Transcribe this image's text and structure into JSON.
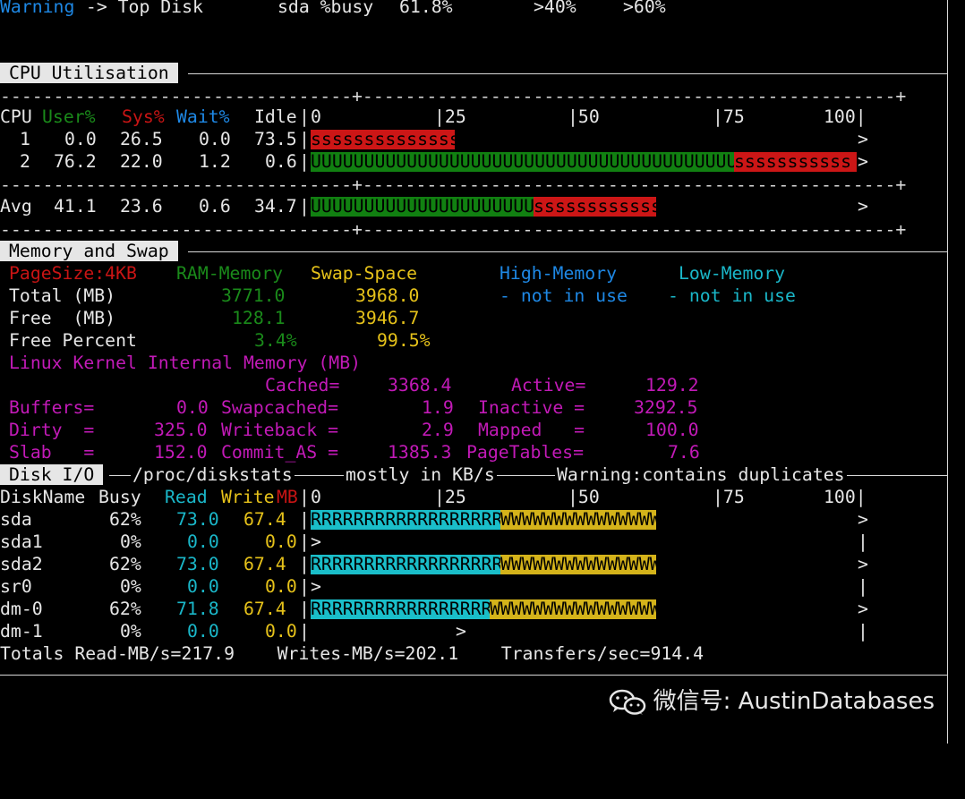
{
  "warning_line": {
    "label": "Warning",
    "text": " -> Top Disk",
    "disk": "sda %busy",
    "busy": "61.8%",
    "t1": ">40%",
    "t2": ">60%"
  },
  "cpu": {
    "title": "CPU Utilisation",
    "ruler_top": "---------------------------+-------------------------------------------------------------+",
    "headers": {
      "cpu": "CPU",
      "user": "User%",
      "sys": "Sys%",
      "wait": "Wait%",
      "idle": "Idle"
    },
    "scale": {
      "s0": "0",
      "s25": "|25",
      "s50": "|50",
      "s75": "|75",
      "s100": "100|"
    },
    "rows": [
      {
        "cpu": "1",
        "user": "0.0",
        "sys": "26.5",
        "wait": "0.0",
        "idle": "73.5",
        "user_pct": 0,
        "sys_pct": 26.5,
        "ubar": "",
        "sbar": "ssssssssssssss",
        "end": ">"
      },
      {
        "cpu": "2",
        "user": "76.2",
        "sys": "22.0",
        "wait": "1.2",
        "idle": "0.6",
        "user_pct": 76.2,
        "sys_pct": 22.0,
        "ubar": "UUUUUUUUUUUUUUUUUUUUUUUUUUUUUUUUUUUUUUUUUUUUU",
        "sbar": "sssssssssss",
        "end": ">"
      }
    ],
    "avg": {
      "label": "Avg",
      "user": "41.1",
      "sys": "23.6",
      "wait": "0.6",
      "idle": "34.7",
      "user_pct": 41.1,
      "sys_pct": 23.6,
      "ubar": "UUUUUUUUUUUUUUUUUUUUUUUU",
      "sbar": "ssssssssssss",
      "end": ">"
    }
  },
  "memory": {
    "title": "Memory and Swap",
    "pagesize": "PageSize:4KB",
    "ram": "RAM-Memory",
    "swap": "Swap-Space",
    "high": "High-Memory",
    "low": "Low-Memory",
    "total_label": "Total (MB)",
    "total_ram": "3771.0",
    "total_swap": "3968.0",
    "high_note": "- not in use",
    "low_note": "- not in use",
    "free_label": "Free  (MB)",
    "free_ram": "128.1",
    "free_swap": "3946.7",
    "fp_label": "Free Percent",
    "fp_ram": "3.4%",
    "fp_swap": "99.5%",
    "kernel_title": "Linux Kernel Internal Memory (MB)",
    "cached_l": "Cached=",
    "cached_v": "3368.4",
    "active_l": "Active=",
    "active_v": "129.2",
    "buffers_l": "Buffers=",
    "buffers_v": "0.0",
    "swapcached_l": "Swapcached=",
    "swapcached_v": "1.9",
    "inactive_l": "Inactive =",
    "inactive_v": "3292.5",
    "dirty_l": "Dirty  =",
    "dirty_v": "325.0",
    "writeback_l": "Writeback =",
    "writeback_v": "2.9",
    "mapped_l": "Mapped   =",
    "mapped_v": "100.0",
    "slab_l": "Slab   =",
    "slab_v": "152.0",
    "commit_l": "Commit_AS =",
    "commit_v": "1385.3",
    "pagetables_l": "PageTables=",
    "pagetables_v": "7.6"
  },
  "disk": {
    "title": "Disk I/O",
    "proc": "/proc/diskstats",
    "mostly": "mostly in KB/s",
    "warn": "Warning:contains duplicates",
    "h_name": "DiskName",
    "h_busy": "Busy",
    "h_read": "Read",
    "h_write": "Write",
    "h_mb": "MB",
    "rows": [
      {
        "name": "sda",
        "busy": "62%",
        "read": "73.0",
        "write": "67.4",
        "rbar": "RRRRRRRRRRRRRRRRRR",
        "wbar": "WWWWWWWWWWWWWWW",
        "read_pct": 34,
        "write_pct": 28,
        "end": ">"
      },
      {
        "name": "sda1",
        "busy": "0%",
        "read": "0.0",
        "write": "0.0",
        "rbar": "",
        "wbar": "",
        "read_pct": 0,
        "write_pct": 0,
        "end": "|",
        "lead": ">"
      },
      {
        "name": "sda2",
        "busy": "62%",
        "read": "73.0",
        "write": "67.4",
        "rbar": "RRRRRRRRRRRRRRRRRR",
        "wbar": "WWWWWWWWWWWWWWW",
        "read_pct": 34,
        "write_pct": 28,
        "end": ">"
      },
      {
        "name": "sr0",
        "busy": "0%",
        "read": "0.0",
        "write": "0.0",
        "rbar": "",
        "wbar": "",
        "read_pct": 0,
        "write_pct": 0,
        "end": "|",
        "lead": ">"
      },
      {
        "name": "dm-0",
        "busy": "62%",
        "read": "71.8",
        "write": "67.4",
        "rbar": "RRRRRRRRRRRRRRRRR",
        "wbar": "WWWWWWWWWWWWWWWW",
        "read_pct": 32,
        "write_pct": 30,
        "end": ">"
      },
      {
        "name": "dm-1",
        "busy": "0%",
        "read": "0.0",
        "write": "0.0",
        "rbar": "",
        "wbar": "",
        "read_pct": 0,
        "write_pct": 0,
        "end": "|",
        "lead": ">"
      }
    ],
    "totals": "Totals Read-MB/s=217.9    Writes-MB/s=202.1    Transfers/sec=914.4"
  },
  "watermark": "微信号: AustinDatabases"
}
